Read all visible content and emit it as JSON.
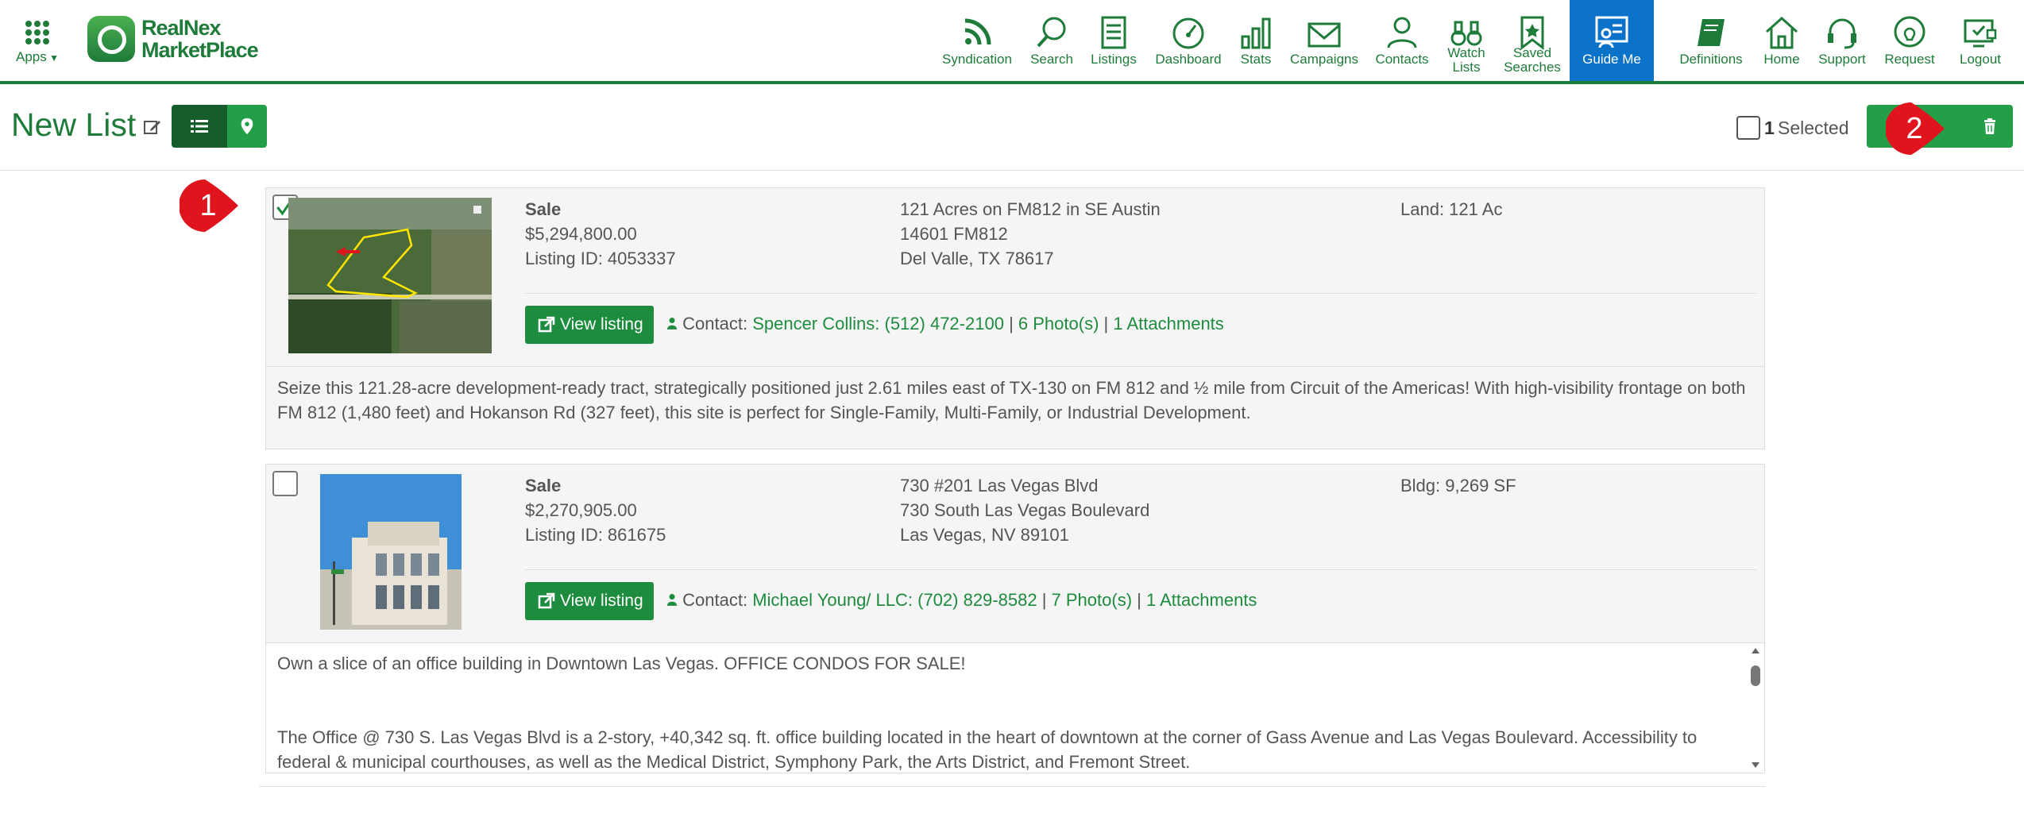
{
  "header": {
    "apps_label": "Apps",
    "logo_line1": "RealNex",
    "logo_line2": "MarketPlace",
    "nav": [
      {
        "label": "Syndication",
        "icon": "rss-icon"
      },
      {
        "label": "Search",
        "icon": "search-icon"
      },
      {
        "label": "Listings",
        "icon": "listings-icon"
      },
      {
        "label": "Dashboard",
        "icon": "dashboard-icon"
      },
      {
        "label": "Stats",
        "icon": "stats-icon"
      },
      {
        "label": "Campaigns",
        "icon": "envelope-icon"
      },
      {
        "label": "Contacts",
        "icon": "person-icon"
      },
      {
        "label": "Watch",
        "label2": "Lists",
        "icon": "binoculars-icon"
      },
      {
        "label": "Saved",
        "label2": "Searches",
        "icon": "bookmark-icon"
      },
      {
        "label": "Guide Me",
        "icon": "guide-icon"
      },
      {
        "label": "Definitions",
        "icon": "book-icon"
      },
      {
        "label": "Home",
        "icon": "home-icon"
      },
      {
        "label": "Support",
        "icon": "headset-icon"
      },
      {
        "label": "Request",
        "icon": "lightbulb-icon"
      },
      {
        "label": "Logout",
        "icon": "logout-icon"
      }
    ]
  },
  "toolbar": {
    "title": "New List",
    "selected_count": "1",
    "selected_label": "Selected"
  },
  "listings": [
    {
      "checked": true,
      "type": "Sale",
      "price": "$5,294,800.00",
      "listing_id": "Listing ID: 4053337",
      "address1": "121 Acres on FM812 in SE Austin",
      "address2": "14601 FM812",
      "address3": "Del Valle, TX 78617",
      "size": "Land: 121 Ac",
      "view_label": "View listing",
      "contact_label": "Contact:",
      "contact_name": "Spencer Collins: (512) 472-2100",
      "photos": "6 Photo(s)",
      "attachments": "1 Attachments",
      "description": "Seize this 121.28-acre development-ready tract, strategically positioned just 2.61 miles east of TX-130 on FM 812 and ½ mile from Circuit of the Americas! With high-visibility frontage on both FM 812 (1,480 feet) and Hokanson Rd (327 feet), this site is perfect for Single-Family, Multi-Family, or Industrial Development."
    },
    {
      "checked": false,
      "type": "Sale",
      "price": "$2,270,905.00",
      "listing_id": "Listing ID: 861675",
      "address1": "730 #201 Las Vegas Blvd",
      "address2": "730 South Las Vegas Boulevard",
      "address3": "Las Vegas, NV 89101",
      "size": "Bldg: 9,269 SF",
      "view_label": "View listing",
      "contact_label": "Contact:",
      "contact_name": "Michael Young/ LLC: (702) 829-8582",
      "photos": "7 Photo(s)",
      "attachments": "1 Attachments",
      "description_p1": "Own a slice of an office building in Downtown Las Vegas. OFFICE CONDOS FOR SALE!",
      "description_p2": "The Office @ 730 S. Las Vegas Blvd is a 2-story, +40,342 sq. ft. office building located in the heart of downtown at the corner of Gass Avenue and Las Vegas Boulevard. Accessibility to federal & municipal courthouses, as well as the Medical District, Symphony Park, the Arts District, and Fremont Street."
    }
  ],
  "markers": [
    {
      "number": "1"
    },
    {
      "number": "2"
    }
  ],
  "colors": {
    "brand_green": "#1e7b3a",
    "button_green": "#23a047",
    "active_blue": "#0a72c8",
    "marker_red": "#e0141c"
  }
}
